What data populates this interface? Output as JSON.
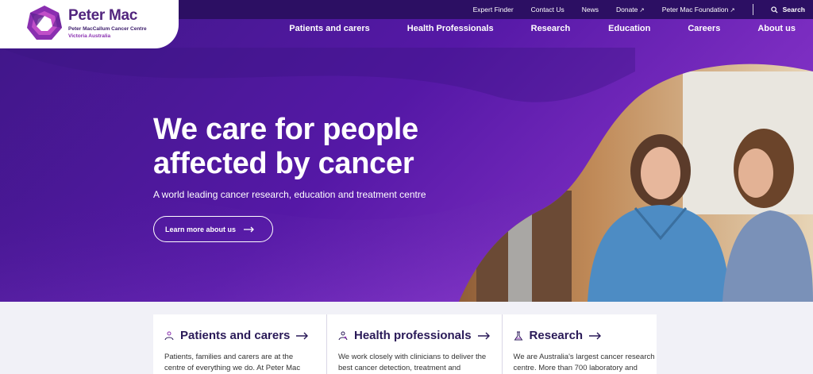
{
  "brand": {
    "name": "Peter Mac",
    "line1": "Peter MacCallum Cancer Centre",
    "line2": "Victoria Australia"
  },
  "utility_nav": {
    "items": [
      {
        "label": "Expert Finder"
      },
      {
        "label": "Contact Us"
      },
      {
        "label": "News"
      },
      {
        "label": "Donate",
        "external": "↗"
      },
      {
        "label": "Peter Mac Foundation",
        "external": "↗"
      }
    ],
    "search_label": "Search"
  },
  "main_nav": {
    "items": [
      "Patients and carers",
      "Health Professionals",
      "Research",
      "Education",
      "Careers",
      "About us"
    ]
  },
  "hero": {
    "title_line1": "We care for people",
    "title_line2": "affected by cancer",
    "subtitle": "A world leading cancer research, education and treatment centre",
    "button_label": "Learn more about us"
  },
  "cards": [
    {
      "title": "Patients and carers",
      "icon": "patients-icon",
      "text": "Patients, families and carers are at the centre of everything we do. At Peter Mac"
    },
    {
      "title": "Health professionals",
      "icon": "health-professionals-icon",
      "text": "We work closely with clinicians to deliver the best cancer detection, treatment and"
    },
    {
      "title": "Research",
      "icon": "research-icon",
      "text": "We are Australia's largest cancer research centre. More than 700 laboratory and"
    }
  ],
  "colors": {
    "brand_purple": "#52257e",
    "topbar": "#2c0f63",
    "hero_start": "#3f1787",
    "hero_end": "#8d3fd0"
  }
}
